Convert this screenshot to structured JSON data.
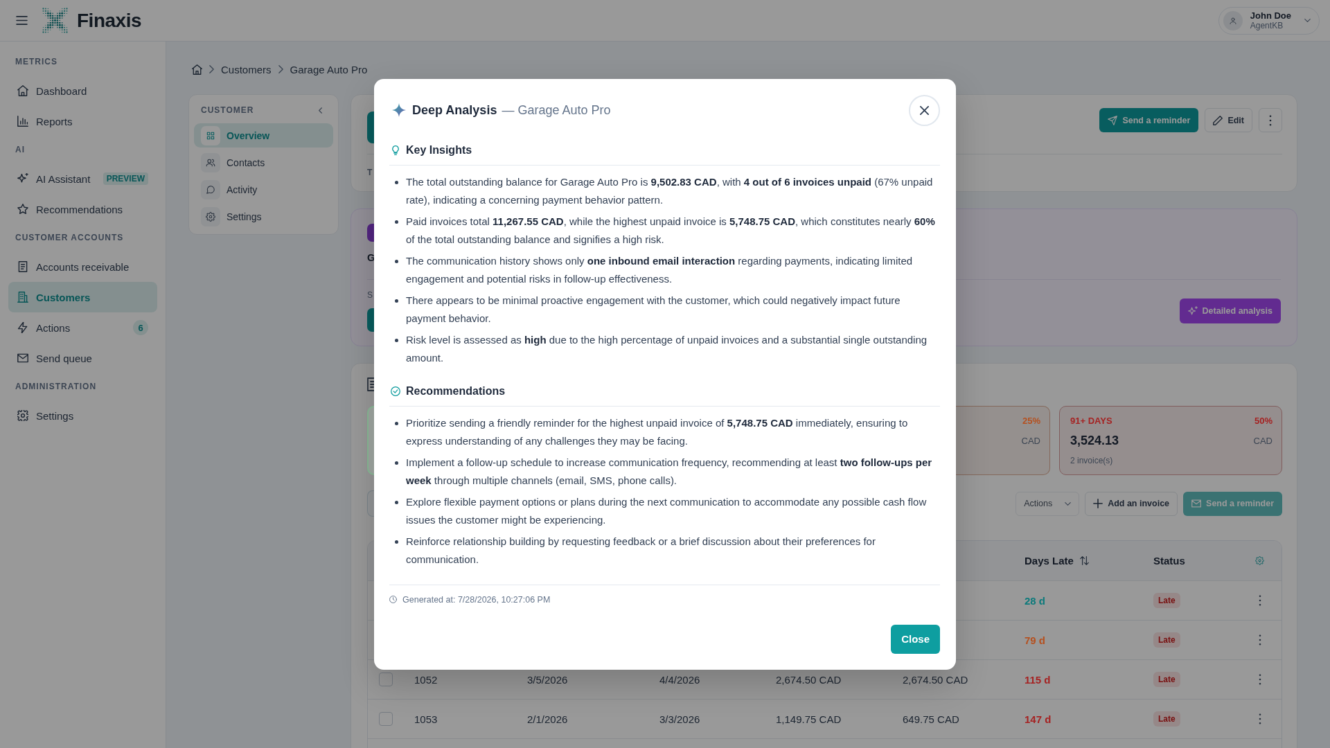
{
  "header": {
    "brand": "Finaxis",
    "user": {
      "name": "John Doe",
      "role": "AgentKB"
    }
  },
  "sidebar": {
    "sections": [
      {
        "title": "METRICS",
        "items": [
          {
            "label": "Dashboard",
            "selected": false
          },
          {
            "label": "Reports",
            "selected": false
          }
        ]
      },
      {
        "title": "AI",
        "items": [
          {
            "label": "AI Assistant",
            "selected": false,
            "badge": "PREVIEW"
          },
          {
            "label": "Recommendations",
            "selected": false
          }
        ]
      },
      {
        "title": "CUSTOMER ACCOUNTS",
        "items": [
          {
            "label": "Accounts receivable",
            "selected": false
          },
          {
            "label": "Customers",
            "selected": true
          },
          {
            "label": "Actions",
            "selected": false,
            "count": "6"
          },
          {
            "label": "Send queue",
            "selected": false
          }
        ]
      },
      {
        "title": "ADMINISTRATION",
        "items": [
          {
            "label": "Settings",
            "selected": false
          }
        ]
      }
    ]
  },
  "breadcrumb": [
    "Customers",
    "Garage Auto Pro"
  ],
  "customer_nav": {
    "title": "CUSTOMER",
    "items": [
      {
        "label": "Overview",
        "selected": true
      },
      {
        "label": "Contacts",
        "selected": false
      },
      {
        "label": "Activity",
        "selected": false
      },
      {
        "label": "Settings",
        "selected": false
      }
    ]
  },
  "summary_card": {
    "label": "T",
    "send_reminder": "Send a reminder",
    "edit": "Edit"
  },
  "ai_card": {
    "title": "G",
    "subtitle": "S",
    "detailed_analysis": "Detailed analysis"
  },
  "invoices_card": {
    "aging": [
      {
        "color": "#7fae8c"
      },
      {
        "percent": "25%",
        "currency": "CAD",
        "color": "#b5501f"
      },
      {
        "label": "91+ DAYS",
        "percent": "50%",
        "amount": "3,524.13",
        "currency": "CAD",
        "count": "2 invoice(s)",
        "color": "#a52222"
      }
    ],
    "toolbar": {
      "actions": {
        "label": "Actions",
        "disabled": true
      },
      "add_invoice": "Add an invoice",
      "send_reminder": {
        "label": "Send a reminder",
        "disabled": true
      }
    },
    "table": {
      "columns": [
        {
          "label": "Days Late",
          "sortable": true
        },
        {
          "label": "Status",
          "sortable": false
        }
      ],
      "rows": [
        {
          "days_late": "28 d",
          "status": "Late",
          "color": "#0d7a7b"
        },
        {
          "days_late": "79 d",
          "status": "Late",
          "color": "#b5501f"
        },
        {
          "checked": false,
          "invoice": "1052",
          "date": "3/5/2026",
          "due_date": "4/4/2026",
          "amount": "2,674.50 CAD",
          "balance": "2,674.50 CAD",
          "days_late": "115 d",
          "status": "Late",
          "color": "#a52222"
        },
        {
          "checked": false,
          "invoice": "1053",
          "date": "2/1/2026",
          "due_date": "3/3/2026",
          "amount": "1,149.75 CAD",
          "balance": "649.75 CAD",
          "days_late": "147 d",
          "status": "Late",
          "color": "#a52222"
        }
      ]
    }
  },
  "modal": {
    "title": "Deep Analysis",
    "subtitle": "— Garage Auto Pro",
    "sections": [
      {
        "kind": "insights",
        "title": "Key Insights",
        "items": [
          "The total outstanding balance for Garage Auto Pro is **9,502.83 CAD**, with **4 out of 6 invoices unpaid** (67% unpaid rate), indicating a concerning payment behavior pattern.",
          "Paid invoices total **11,267.55 CAD**, while the highest unpaid invoice is **5,748.75 CAD**, which constitutes nearly **60%** of the total outstanding balance and signifies a high risk.",
          "The communication history shows only **one inbound email interaction** regarding payments, indicating limited engagement and potential risks in follow-up effectiveness.",
          "There appears to be minimal proactive engagement with the customer, which could negatively impact future payment behavior.",
          "Risk level is assessed as **high** due to the high percentage of unpaid invoices and a substantial single outstanding amount."
        ]
      },
      {
        "kind": "recommendations",
        "title": "Recommendations",
        "items": [
          "Prioritize sending a friendly reminder for the highest unpaid invoice of **5,748.75 CAD** immediately, ensuring to express understanding of any challenges they may be facing.",
          "Implement a follow-up schedule to increase communication frequency, recommending at least **two follow-ups per week** through multiple channels (email, SMS, phone calls).",
          "Explore flexible payment options or plans during the next communication to accommodate any possible cash flow issues the customer might be experiencing.",
          "Reinforce relationship building by requesting feedback or a brief discussion about their preferences for communication."
        ]
      }
    ],
    "generated_at": "Generated at: 7/28/2026, 10:27:06 PM",
    "close_button": "Close"
  }
}
